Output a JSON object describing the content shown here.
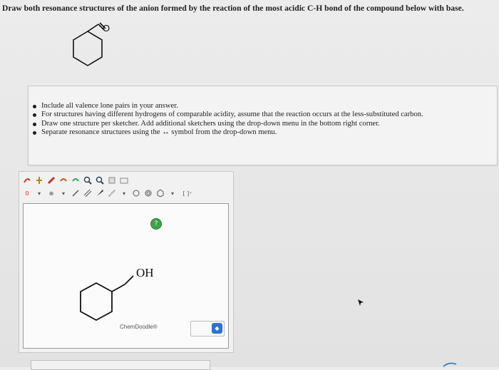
{
  "question": {
    "text": "Draw both resonance structures of the anion formed by the reaction of the most acidic C-H bond of the compound below with base."
  },
  "molecule": {
    "atom_label": "O"
  },
  "instructions": {
    "items": [
      "Include all valence lone pairs in your answer.",
      "For structures having different hydrogens of comparable acidity, assume that the reaction occurs at the less-substituted carbon.",
      "Draw one structure per sketcher. Add additional sketchers using the drop-down menu in the bottom right corner.",
      "Separate resonance structures using the ↔ symbol from the drop-down menu."
    ]
  },
  "sketcher": {
    "charge_value": "0",
    "bracket_tool": "[ ]⁺",
    "canvas_label": "OH",
    "footer_label": "ChemDoodle®",
    "help_symbol": "?"
  },
  "colors": {
    "help_badge": "#3ea24a",
    "select_arrow": "#2f6fd6"
  }
}
